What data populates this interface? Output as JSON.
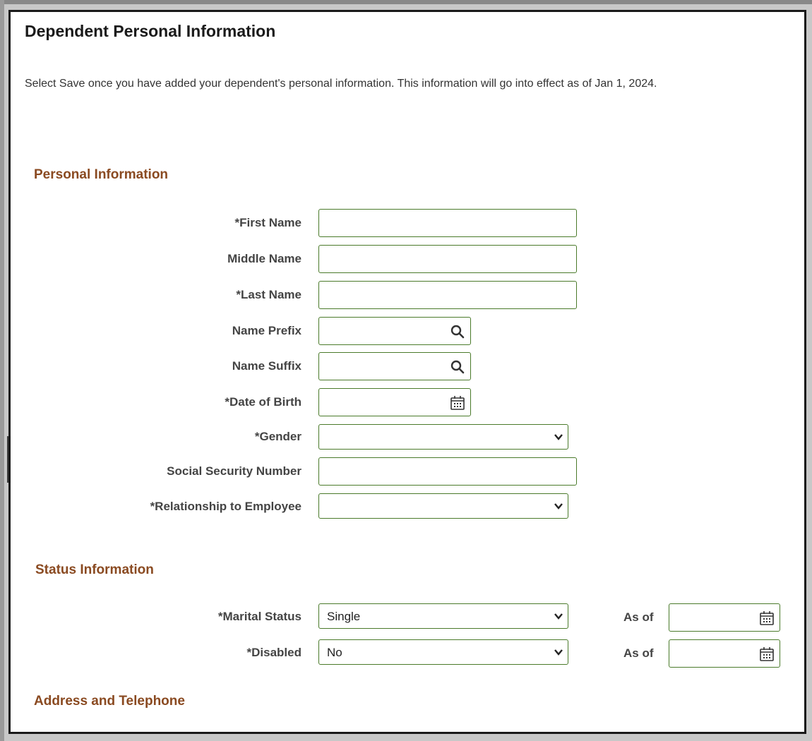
{
  "page": {
    "title": "Dependent Personal Information",
    "intro": "Select Save once you have added your dependent's personal information. This information will go into effect as of Jan 1, 2024."
  },
  "personal": {
    "heading": "Personal Information",
    "first_name": "*First Name",
    "middle_name": "Middle Name",
    "last_name": "*Last Name",
    "name_prefix": "Name Prefix",
    "name_suffix": "Name Suffix",
    "dob": "*Date of Birth",
    "gender": "*Gender",
    "ssn": "Social Security Number",
    "relationship": "*Relationship to Employee",
    "gender_value": "",
    "relationship_value": ""
  },
  "status": {
    "heading": "Status Information",
    "marital_label": "*Marital Status",
    "marital_value": "Single",
    "disabled_label": "*Disabled",
    "disabled_value": "No",
    "as_of_label": "As of"
  },
  "address": {
    "heading": "Address and Telephone"
  },
  "icons": {
    "lookup": "search-icon",
    "calendar": "calendar-icon",
    "dropdown": "chevron-down-icon"
  },
  "colors": {
    "section_heading": "#8a4a21",
    "field_border": "#4a7a2a"
  }
}
